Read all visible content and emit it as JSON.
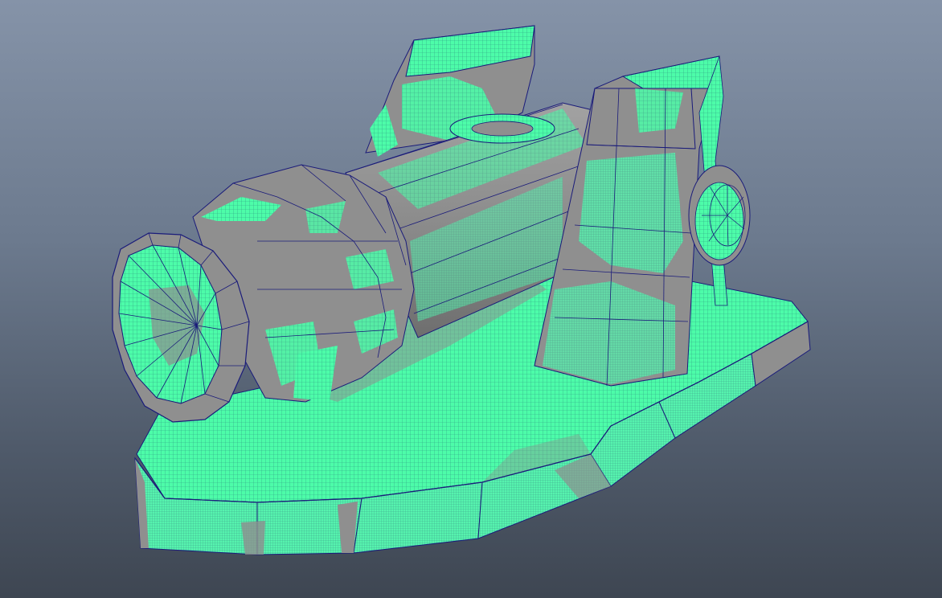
{
  "viewport": {
    "background_top": "#8593a8",
    "background_bottom": "#3e4652"
  },
  "model": {
    "subject": "cannon-on-base",
    "shaded_color": "#8f8f8f",
    "selection_color": "#4dfca9",
    "wire_color": "#1a1b7a"
  }
}
